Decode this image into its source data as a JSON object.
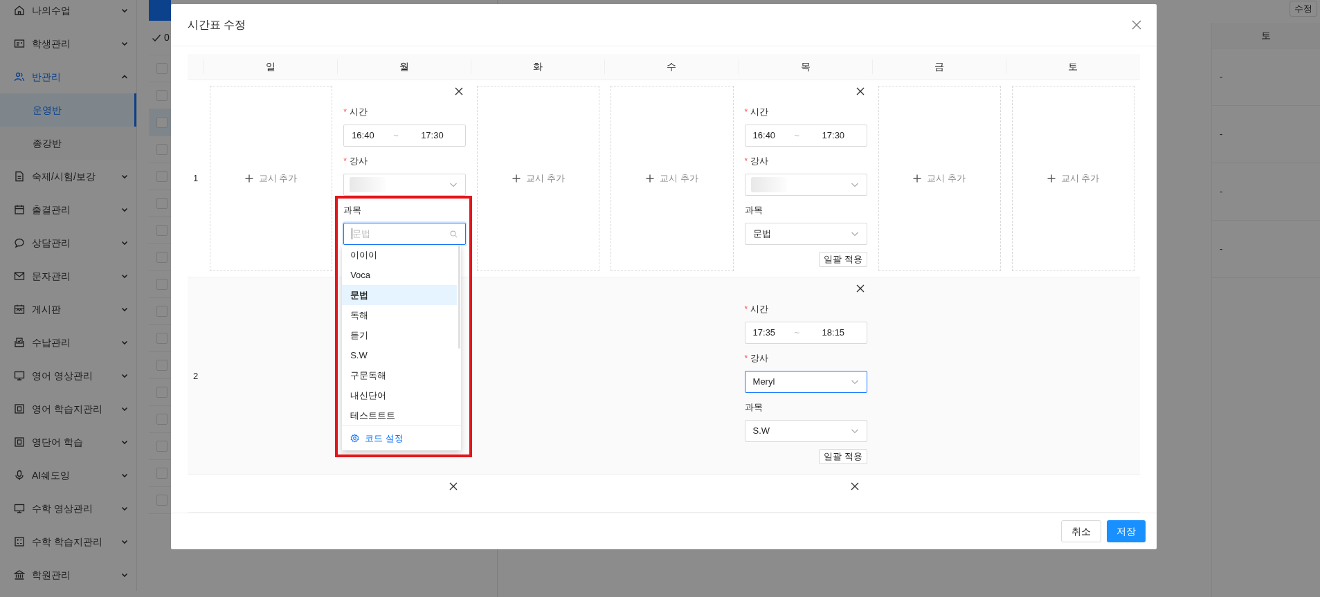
{
  "sidebar": {
    "items": [
      {
        "label": "나의수업",
        "expanded": false
      },
      {
        "label": "학생관리",
        "expanded": false
      },
      {
        "label": "반관리",
        "expanded": true,
        "children": [
          {
            "label": "운영반",
            "selected": true
          },
          {
            "label": "종강반",
            "selected": false
          }
        ]
      },
      {
        "label": "숙제/시험/보강",
        "expanded": false
      },
      {
        "label": "출결관리",
        "expanded": false
      },
      {
        "label": "상담관리",
        "expanded": false
      },
      {
        "label": "문자관리",
        "expanded": false
      },
      {
        "label": "게시판",
        "expanded": false
      },
      {
        "label": "수납관리",
        "expanded": false
      },
      {
        "label": "영어 영상관리",
        "expanded": false
      },
      {
        "label": "영어 학습지관리",
        "expanded": false
      },
      {
        "label": "영단어 학습",
        "expanded": false
      },
      {
        "label": "AI쉐도잉",
        "expanded": false
      },
      {
        "label": "수학 영상관리",
        "expanded": false
      },
      {
        "label": "수학 학습지관리",
        "expanded": false
      },
      {
        "label": "학원관리",
        "expanded": false
      }
    ]
  },
  "class_list": {
    "selected_count": "0",
    "rows": [
      {
        "selected": false
      },
      {
        "selected": false
      },
      {
        "selected": true
      },
      {
        "selected": false
      },
      {
        "selected": false
      },
      {
        "selected": false
      },
      {
        "selected": false
      },
      {
        "selected": false
      },
      {
        "selected": false
      },
      {
        "selected": false
      },
      {
        "selected": false
      },
      {
        "selected": false
      },
      {
        "selected": false
      },
      {
        "selected": false
      },
      {
        "selected": false
      },
      {
        "selected": false
      },
      {
        "selected": false
      }
    ]
  },
  "schedule": {
    "edit_button": "수정",
    "column": "토",
    "cells": [
      "-",
      "-",
      "-",
      "-"
    ]
  },
  "modal": {
    "title": "시간표 수정",
    "days": [
      "일",
      "월",
      "화",
      "수",
      "목",
      "금",
      "토"
    ],
    "rows": [
      {
        "number": "1",
        "cells": [
          {
            "kind": "add",
            "label": "교시 추가"
          },
          {
            "kind": "period",
            "time_mark": "*",
            "time_label": "시간",
            "start": "16:40",
            "separator": "~",
            "end": "17:30",
            "teacher_mark": "*",
            "teacher_label": "강사",
            "teacher_blurred": true,
            "teacher_focused": false,
            "subject_label": "과목",
            "subject_open": true,
            "search_placeholder": "문법",
            "options": [
              {
                "label": "이이이",
                "selected": false
              },
              {
                "label": "Voca",
                "selected": false
              },
              {
                "label": "문법",
                "selected": true
              },
              {
                "label": "독해",
                "selected": false
              },
              {
                "label": "듣기",
                "selected": false
              },
              {
                "label": "S.W",
                "selected": false
              },
              {
                "label": "구문독해",
                "selected": false
              },
              {
                "label": "내신단어",
                "selected": false
              },
              {
                "label": "테스트트트",
                "selected": false
              }
            ],
            "options_footer": "코드 설정"
          },
          {
            "kind": "add",
            "label": "교시 추가"
          },
          {
            "kind": "add",
            "label": "교시 추가"
          },
          {
            "kind": "period",
            "time_mark": "*",
            "time_label": "시간",
            "start": "16:40",
            "separator": "~",
            "end": "17:30",
            "teacher_mark": "*",
            "teacher_label": "강사",
            "teacher_blurred": true,
            "teacher_focused": false,
            "subject_label": "과목",
            "subject_open": false,
            "subject": "문법",
            "apply": "일괄 적용"
          },
          {
            "kind": "add",
            "label": "교시 추가"
          },
          {
            "kind": "add",
            "label": "교시 추가"
          }
        ]
      },
      {
        "number": "2",
        "cells": [
          {
            "kind": "empty"
          },
          {
            "kind": "empty"
          },
          {
            "kind": "empty"
          },
          {
            "kind": "empty"
          },
          {
            "kind": "period",
            "time_mark": "*",
            "time_label": "시간",
            "start": "17:35",
            "separator": "~",
            "end": "18:15",
            "teacher_mark": "*",
            "teacher_label": "강사",
            "teacher_blurred": false,
            "teacher": "Meryl",
            "teacher_focused": true,
            "subject_label": "과목",
            "subject_open": false,
            "subject": "S.W",
            "apply": "일괄 적용"
          },
          {
            "kind": "empty"
          },
          {
            "kind": "empty"
          }
        ]
      },
      {
        "cells": [
          {
            "kind": "empty"
          },
          {
            "kind": "top"
          },
          {
            "kind": "empty"
          },
          {
            "kind": "empty"
          },
          {
            "kind": "top"
          },
          {
            "kind": "empty"
          },
          {
            "kind": "empty"
          }
        ]
      }
    ],
    "cancel": "취소",
    "save": "저장"
  }
}
